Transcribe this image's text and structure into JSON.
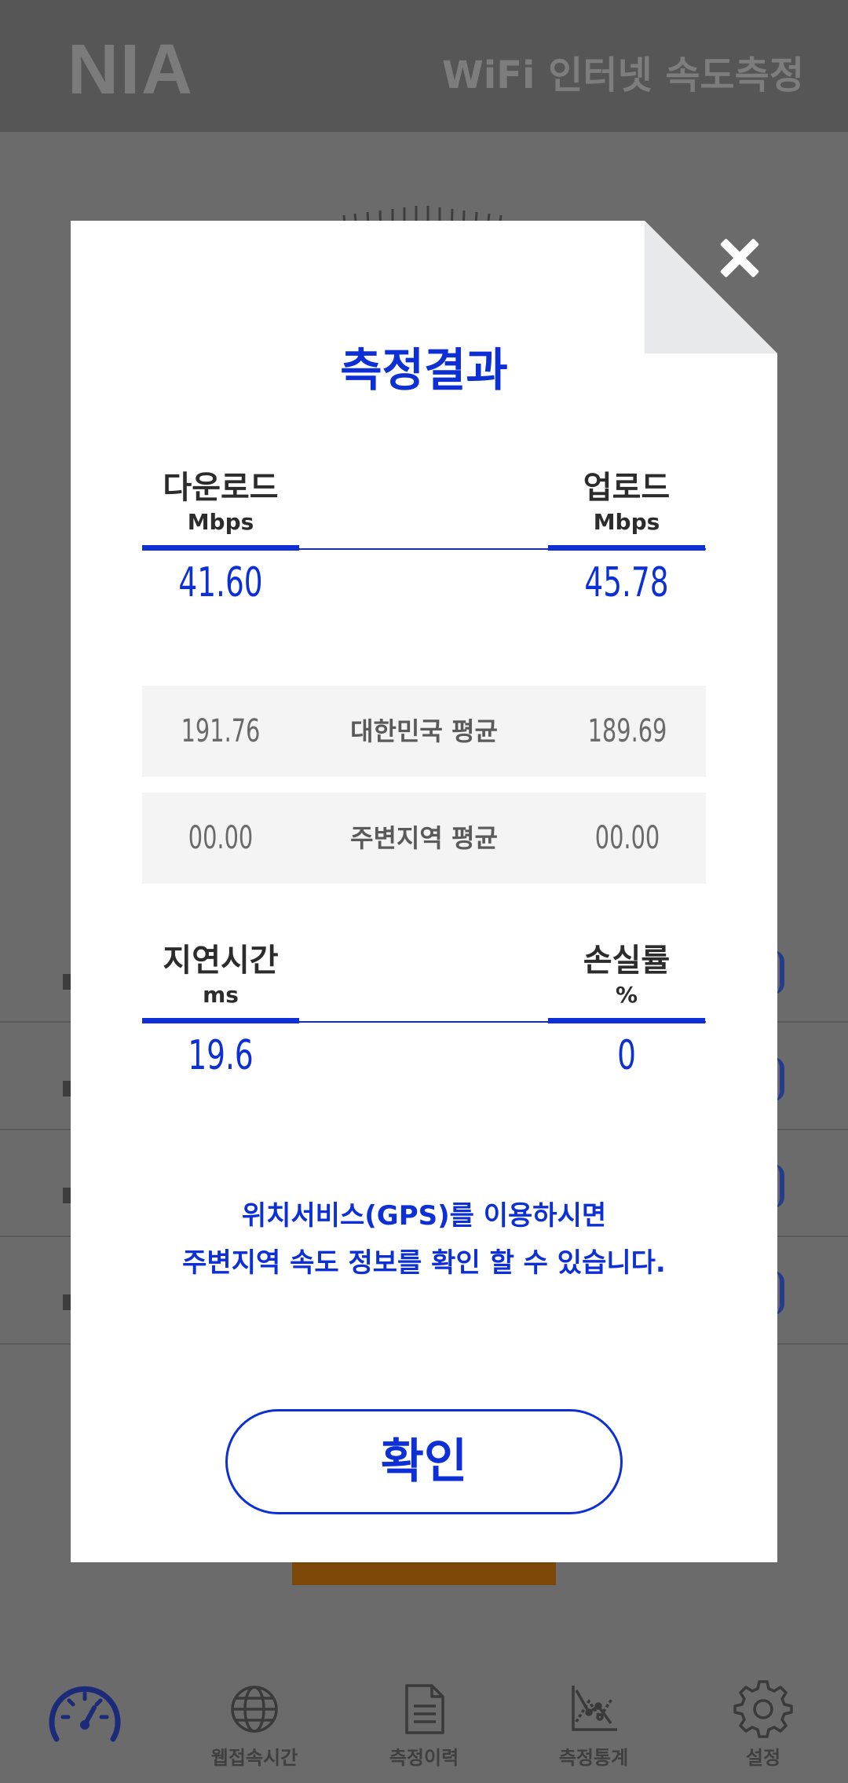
{
  "header": {
    "logo": "NIA",
    "title": "WiFi 인터넷 속도측정"
  },
  "modal": {
    "title": "측정결과",
    "download": {
      "label": "다운로드",
      "unit": "Mbps",
      "value": "41.60"
    },
    "upload": {
      "label": "업로드",
      "unit": "Mbps",
      "value": "45.78"
    },
    "national_avg": {
      "label": "대한민국 평균",
      "download": "191.76",
      "upload": "189.69"
    },
    "local_avg": {
      "label": "주변지역 평균",
      "download": "00.00",
      "upload": "00.00"
    },
    "latency": {
      "label": "지연시간",
      "unit": "ms",
      "value": "19.6"
    },
    "loss": {
      "label": "손실률",
      "unit": "%",
      "value": "0"
    },
    "gps_note_line1": "위치서비스(GPS)를 이용하시면",
    "gps_note_line2": "주변지역 속도 정보를 확인 할 수 있습니다.",
    "confirm_label": "확인"
  },
  "bottom_nav": {
    "items": [
      {
        "label": "",
        "icon": "speedometer-icon",
        "active": true
      },
      {
        "label": "웹접속시간",
        "icon": "globe-icon"
      },
      {
        "label": "측정이력",
        "icon": "document-icon"
      },
      {
        "label": "측정통계",
        "icon": "chart-icon"
      },
      {
        "label": "설정",
        "icon": "gear-icon"
      }
    ]
  },
  "colors": {
    "accent": "#0d2fd6",
    "overlay": "#6b6b6b",
    "fold": "#e8e9ea"
  }
}
